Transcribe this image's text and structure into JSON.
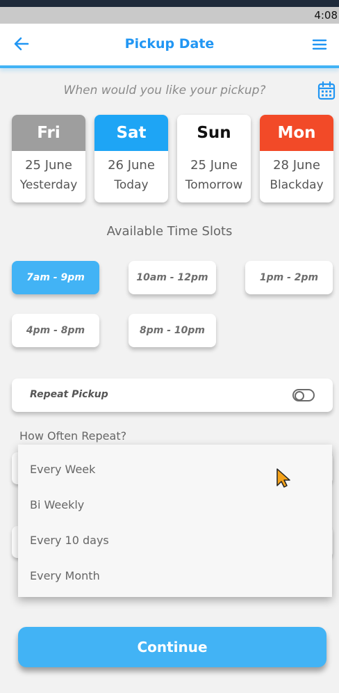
{
  "status": {
    "time": "4:08"
  },
  "appbar": {
    "title": "Pickup Date"
  },
  "question": "When would you like your pickup?",
  "days": [
    {
      "day": "Fri",
      "date": "25 June",
      "relative": "Yesterday",
      "color": "#9e9e9e"
    },
    {
      "day": "Sat",
      "date": "26 June",
      "relative": "Today",
      "color": "#1ea5f5"
    },
    {
      "day": "Sun",
      "date": "25 June",
      "relative": "Tomorrow",
      "color": "#ffffff"
    },
    {
      "day": "Mon",
      "date": "28 June",
      "relative": "Blackday",
      "color": "#f24a28"
    }
  ],
  "slots_title": "Available Time Slots",
  "slots": [
    {
      "label": "7am - 9pm",
      "selected": true
    },
    {
      "label": "10am - 12pm",
      "selected": false
    },
    {
      "label": "1pm - 2pm",
      "selected": false
    },
    {
      "label": "4pm - 8pm",
      "selected": false
    },
    {
      "label": "8pm - 10pm",
      "selected": false
    }
  ],
  "repeat": {
    "label": "Repeat Pickup",
    "enabled": false
  },
  "how_often": {
    "label": "How Often Repeat?",
    "options": [
      "Every Week",
      "Bi Weekly",
      "Every 10 days",
      "Every Month"
    ]
  },
  "continue_label": "Continue",
  "colors": {
    "accent": "#42b3f5",
    "title": "#2196f3"
  },
  "icons": {
    "back": "arrow-left-icon",
    "menu": "hamburger-menu-icon",
    "calendar": "calendar-icon",
    "cursor": "mouse-pointer-icon"
  }
}
